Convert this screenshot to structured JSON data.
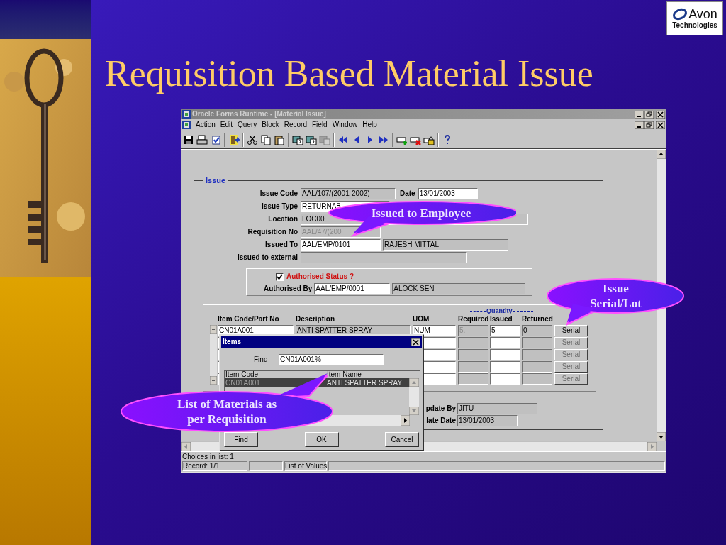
{
  "slide": {
    "title": "Requisition Based Material Issue",
    "logo": {
      "mark": "Avon",
      "subtitle": "Technologies"
    }
  },
  "window": {
    "title": "Oracle Forms Runtime - [Material Issue]",
    "menu": [
      "Action",
      "Edit",
      "Query",
      "Block",
      "Record",
      "Field",
      "Window",
      "Help"
    ],
    "issue": {
      "legend": "Issue",
      "fields": [
        {
          "kind": "code_date",
          "label": "Issue Code",
          "value": "AAL/107/(2001-2002)",
          "editable": false,
          "side_label": "Date",
          "side_value": "13/01/2003"
        },
        {
          "kind": "code",
          "label": "Issue Type",
          "value": "RETURNAB",
          "editable": true
        },
        {
          "kind": "code_desc",
          "label": "Location",
          "value": "LOC00",
          "editable": false
        },
        {
          "kind": "code",
          "label": "Requisition No",
          "value": "AAL/47/(200",
          "editable": false
        },
        {
          "kind": "code_desc",
          "label": "Issued To",
          "value": "AAL/EMP/0101",
          "editable": true,
          "desc": "RAJESH MITTAL"
        },
        {
          "kind": "code",
          "label": "Issued to external",
          "editable": false
        }
      ],
      "authorised": {
        "label": "Authorised Status ?",
        "checked": true
      },
      "authorised_by": {
        "label": "Authorised By",
        "value": "AAL/EMP/0001",
        "desc": "ALOCK SEN"
      },
      "grid": {
        "quantity_label": "Quantity",
        "columns": [
          {
            "label": "Item Code/Part No",
            "editable": true
          },
          {
            "label": "Description",
            "editable": false
          },
          {
            "label": "UOM",
            "editable": true
          },
          {
            "label": "Required",
            "editable": false
          },
          {
            "label": "Issued",
            "editable": true
          },
          {
            "label": "Returned",
            "editable": false
          }
        ],
        "rows": [
          {
            "cells": [
              "CN01A001",
              "ANTI SPATTER SPRAY",
              "NUM",
              "5.",
              "5",
              "0"
            ],
            "serial": "Serial",
            "serial_enabled": true
          },
          {
            "serial": "Serial",
            "serial_enabled": false
          },
          {
            "serial": "Serial",
            "serial_enabled": false
          },
          {
            "serial": "Serial",
            "serial_enabled": false
          },
          {
            "serial": "Serial",
            "serial_enabled": false
          }
        ]
      },
      "updates": [
        {
          "label": "pdate By",
          "value": "JITU"
        },
        {
          "label": "late Date",
          "value": "13/01/2003"
        }
      ]
    },
    "dialog": {
      "title": "Items",
      "find_label": "Find",
      "find_value": "CN01A001%",
      "columns": [
        "Item Code",
        "Item Name"
      ],
      "rows": [
        {
          "code": "CN01A001",
          "name": "ANTI SPATTER SPRAY",
          "selected": true
        }
      ],
      "buttons": [
        "Find",
        "OK",
        "Cancel"
      ]
    },
    "status": {
      "message": "Choices in list: 1",
      "record": "Record: 1/1",
      "mode": "List of Values"
    }
  },
  "callouts": [
    {
      "lines": [
        "Issued to Employee"
      ]
    },
    {
      "lines": [
        "Issue",
        "Serial/Lot"
      ]
    },
    {
      "lines": [
        "List of Materials as",
        "per Requisition"
      ]
    }
  ]
}
